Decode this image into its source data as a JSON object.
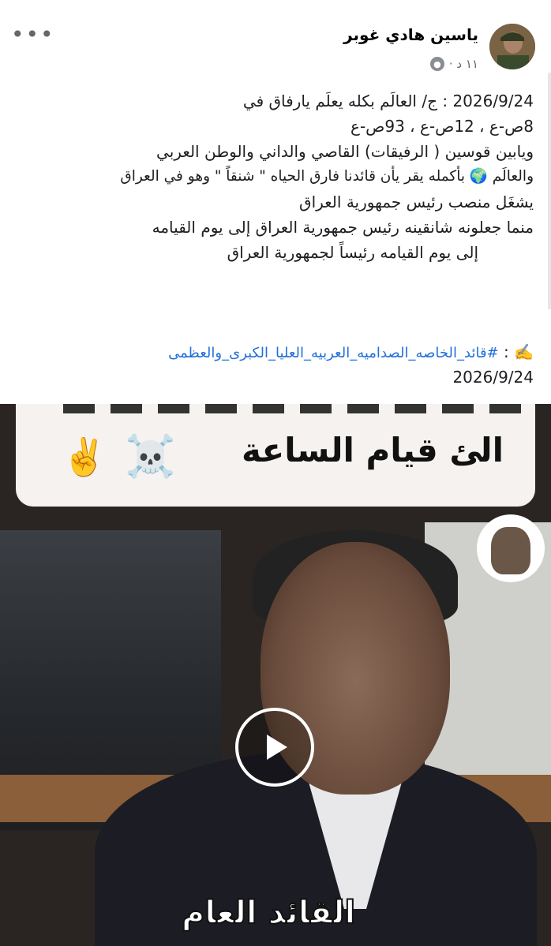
{
  "post": {
    "author": "ياسين هادي غوبر",
    "time": "١١ د ·",
    "more": "•••",
    "lines": [
      "2026/9/24 : ج/ العالَم بكله يعلَم يارفاق في",
      "8ص-ع  ،  12ص-ع  ،  93ص-ع",
      "ويابين قوسين ( الرفيقات) القاصي والداني والوطن العربي",
      "والعالَم 🌍 بأكمله يقر يأن قائدنا فارق الحياه \" شنقاً \" وهو في العراق",
      "يشغَل منصب رئيس جمهورية العراق",
      "منما جعلونه شانقينه رئيس جمهورية العراق إلى يوم القيامه",
      "إلى يوم القيامه رئيساً لجمهورية العراق"
    ],
    "hashtag_prefix": "✍️ : ",
    "hashtag": "#قائد_الخاصه_الصداميه_العربيه_العليا_الكبرى_والعظمى",
    "date": "2026/9/24"
  },
  "video": {
    "caption": "الئ قيام الساعة",
    "emoji_peace": "✌️",
    "emoji_skull": "☠️",
    "bottom_caption": "القائد العام"
  }
}
